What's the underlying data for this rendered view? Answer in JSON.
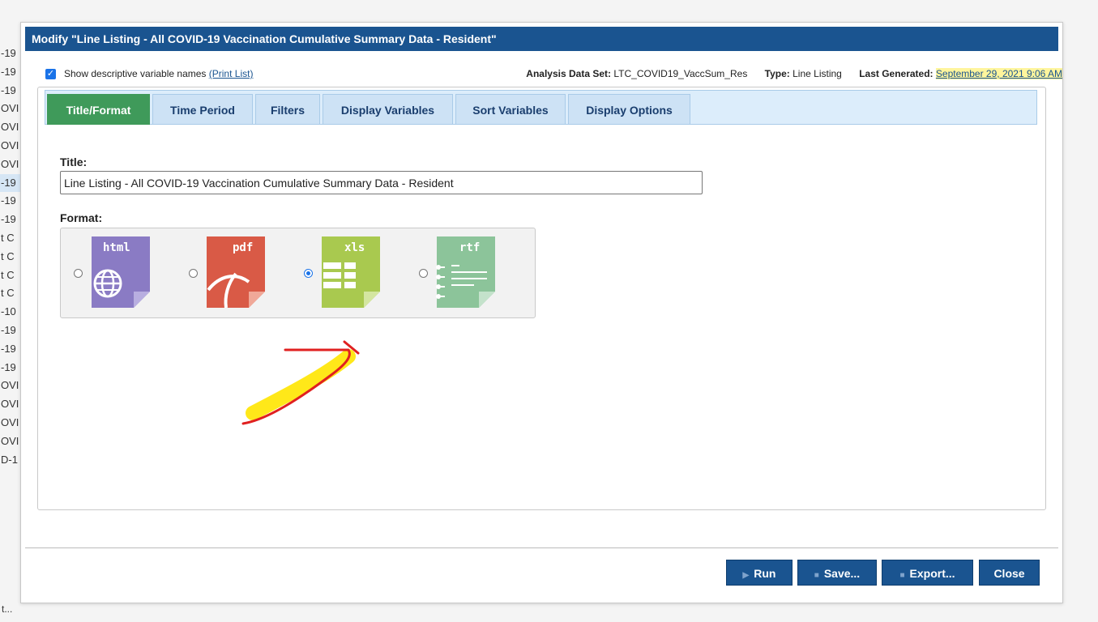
{
  "background_list": {
    "items": [
      "-19",
      "-19",
      "-19",
      "OVI",
      "OVI",
      "OVI",
      "OVI",
      "-19",
      "-19",
      "-19",
      "t C",
      "t C",
      "t C",
      "t C",
      "-10",
      "-19",
      "-19",
      "-19",
      "OVI",
      "OVI",
      "OVI",
      "OVI",
      "D-1"
    ],
    "selected_index": 7,
    "bottom_text": "t..."
  },
  "dialog": {
    "title": "Modify \"Line Listing - All COVID-19 Vaccination Cumulative Summary Data - Resident\"",
    "show_descriptive": {
      "label": "Show descriptive variable names",
      "checked": true,
      "link": "(Print List)"
    },
    "meta": {
      "dataset_label": "Analysis Data Set:",
      "dataset_value": "LTC_COVID19_VaccSum_Res",
      "type_label": "Type:",
      "type_value": "Line Listing",
      "generated_label": "Last Generated:",
      "generated_value": "September 29, 2021 9:06 AM"
    },
    "tabs": [
      {
        "label": "Title/Format",
        "active": true
      },
      {
        "label": "Time Period",
        "active": false
      },
      {
        "label": "Filters",
        "active": false
      },
      {
        "label": "Display Variables",
        "active": false
      },
      {
        "label": "Sort Variables",
        "active": false
      },
      {
        "label": "Display Options",
        "active": false
      }
    ],
    "title_label": "Title:",
    "title_value": "Line Listing - All COVID-19 Vaccination Cumulative Summary Data - Resident",
    "format_label": "Format:",
    "formats": [
      {
        "label": "html",
        "color": "#8a7bc4",
        "icon": "globe-icon",
        "selected": false
      },
      {
        "label": "pdf",
        "color": "#d95a46",
        "icon": "acrobat-icon",
        "selected": false
      },
      {
        "label": "xls",
        "color": "#a9c94f",
        "icon": "spreadsheet-icon",
        "selected": true
      },
      {
        "label": "rtf",
        "color": "#8cc49a",
        "icon": "document-icon",
        "selected": false
      }
    ],
    "buttons": {
      "run": "Run",
      "save": "Save...",
      "export": "Export...",
      "close": "Close"
    }
  },
  "colors": {
    "header": "#1a5490",
    "active_tab": "#3f9a5a",
    "tab_bar": "#dcedfb",
    "annotation_arrow": "#e02020",
    "annotation_highlight": "#ffe600"
  }
}
